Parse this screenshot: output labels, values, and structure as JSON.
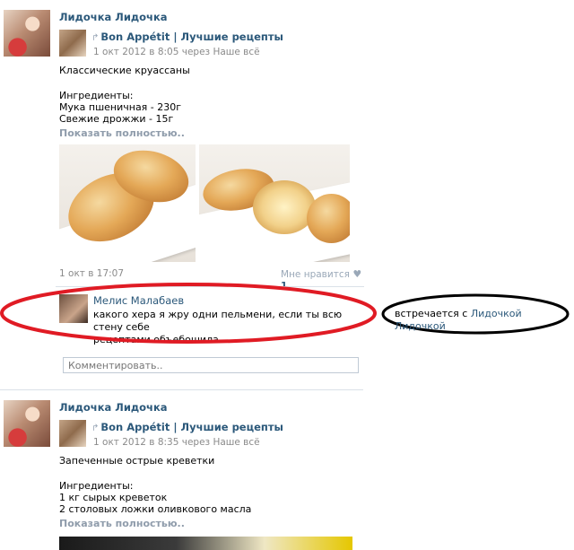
{
  "post1": {
    "author": "Лидочка Лидочка",
    "group": "Bon Appétit | Лучшие рецепты",
    "group_meta": "1 окт 2012 в 8:05 через Наше всё",
    "title": "Классические круассаны",
    "ingredients_header": "Ингредиенты:",
    "ingredient_1": "Мука пшеничная - 230г",
    "ingredient_2": "Свежие дрожжи - 15г",
    "show_more": "Показать полностью..",
    "date": "1 окт в 17:07",
    "like_label": "Мне нравится",
    "like_count": "1"
  },
  "comment": {
    "author": "Мелис Малабаев",
    "text_line1": "какого хера я жру одни пельмени, если ты всю стену себе",
    "text_line2": "рецептами объебошила"
  },
  "comment_placeholder": "Комментировать..",
  "annotation": {
    "prefix": "встречается с",
    "name": "Лидочкой Лидочкой"
  },
  "post2": {
    "author": "Лидочка Лидочка",
    "group": "Bon Appétit | Лучшие рецепты",
    "group_meta": "1 окт 2012 в 8:35 через Наше всё",
    "title": "Запеченные острые креветки",
    "ingredients_header": "Ингредиенты:",
    "ingredient_1": "1 кг сырых креветок",
    "ingredient_2": "2 столовых ложки оливкового масла",
    "show_more": "Показать полностью.."
  },
  "colors": {
    "link": "#2b587a",
    "red_ellipse": "#e01b24",
    "black_ellipse": "#000000"
  }
}
